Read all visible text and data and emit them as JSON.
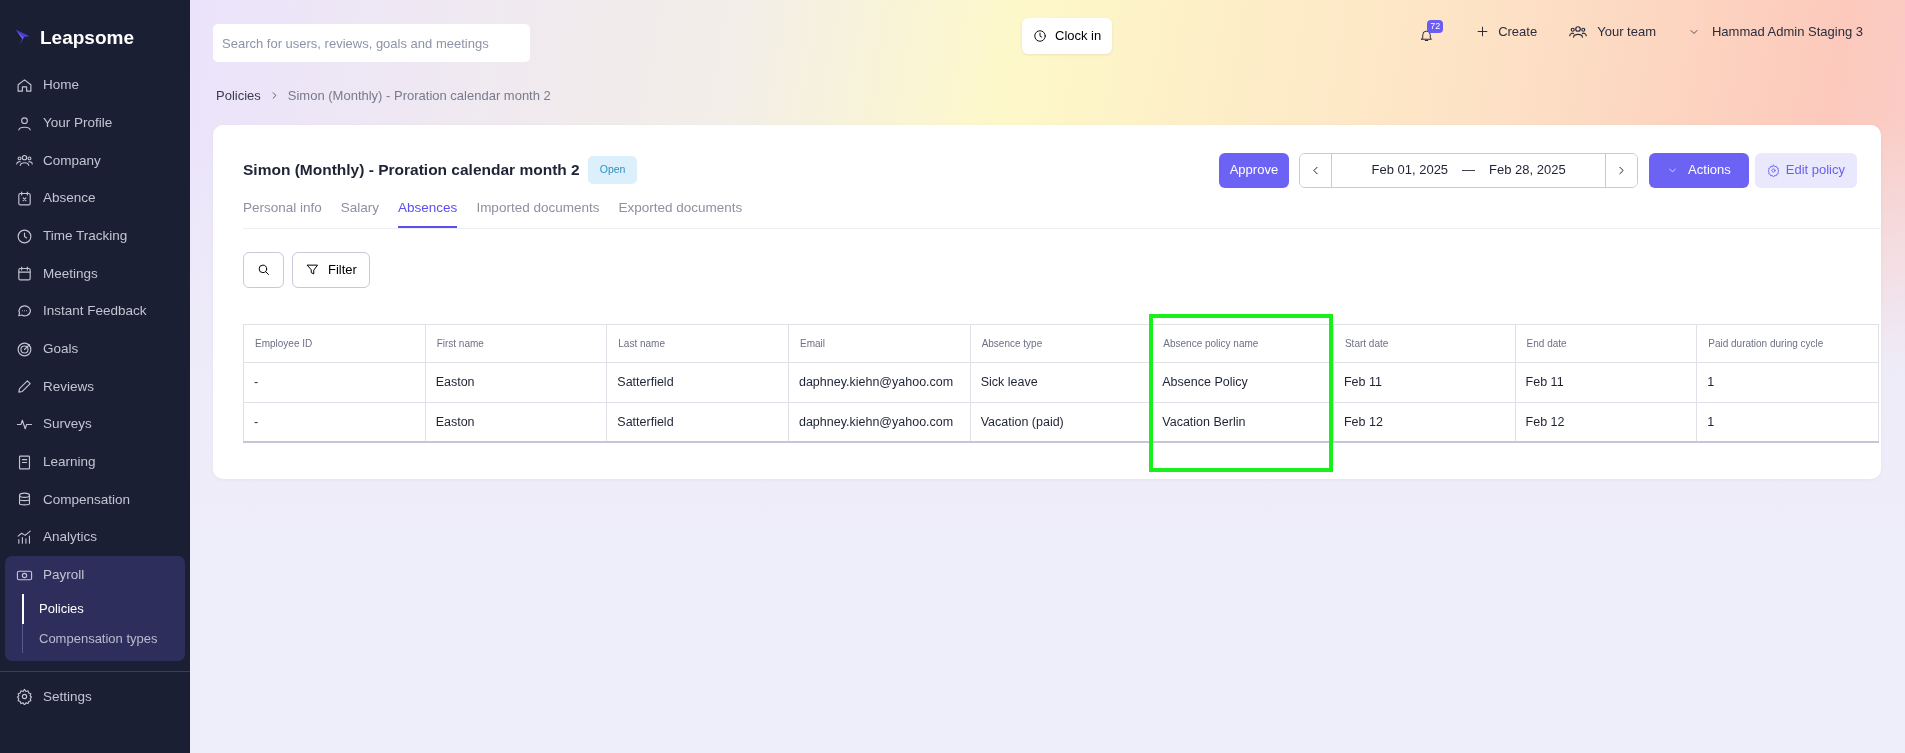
{
  "sidebar": {
    "logo": "Leapsome",
    "items": [
      {
        "label": "Home",
        "selected": false
      },
      {
        "label": "Your Profile",
        "selected": false
      },
      {
        "label": "Company",
        "selected": false
      },
      {
        "label": "Absence",
        "selected": false
      },
      {
        "label": "Time Tracking",
        "selected": false
      },
      {
        "label": "Meetings",
        "selected": false
      },
      {
        "label": "Instant Feedback",
        "selected": false
      },
      {
        "label": "Goals",
        "selected": false
      },
      {
        "label": "Reviews",
        "selected": false
      },
      {
        "label": "Surveys",
        "selected": false
      },
      {
        "label": "Learning",
        "selected": false
      },
      {
        "label": "Compensation",
        "selected": false
      },
      {
        "label": "Analytics",
        "selected": false
      },
      {
        "label": "Payroll",
        "selected": false,
        "expanded": true,
        "children": [
          {
            "label": "Policies",
            "selected": true
          },
          {
            "label": "Compensation types",
            "selected": false
          }
        ]
      }
    ],
    "footer_items": [
      {
        "label": "Settings"
      }
    ]
  },
  "topbar": {
    "search": {
      "placeholder": "Search for users, reviews, goals and meetings"
    },
    "clock_in": "Clock in",
    "notifications_count": "72",
    "create": "Create",
    "your_team": "Your team",
    "user": "Hammad Admin Staging 3"
  },
  "breadcrumb": [
    "Policies",
    "Simon (Monthly) - Proration calendar month 2"
  ],
  "policy": {
    "title": "Simon (Monthly) - Proration calendar month 2",
    "status": "Open",
    "approve": "Approve",
    "date_from": "Feb 01, 2025",
    "date_to": "Feb 28, 2025",
    "separator": "—",
    "actions": "Actions",
    "edit": "Edit policy",
    "tabs": [
      {
        "label": "Personal info",
        "selected": false
      },
      {
        "label": "Salary",
        "selected": false
      },
      {
        "label": "Absences",
        "selected": true
      },
      {
        "label": "Imported documents",
        "selected": false
      },
      {
        "label": "Exported documents",
        "selected": false
      }
    ],
    "filter": "Filter",
    "table": {
      "columns": [
        {
          "label": "Employee ID",
          "highlighted": false
        },
        {
          "label": "First name",
          "highlighted": false
        },
        {
          "label": "Last name",
          "highlighted": false
        },
        {
          "label": "Email",
          "highlighted": false
        },
        {
          "label": "Absence type",
          "highlighted": false
        },
        {
          "label": "Absence policy name",
          "highlighted": true
        },
        {
          "label": "Start date",
          "highlighted": false
        },
        {
          "label": "End date",
          "highlighted": false
        },
        {
          "label": "Paid duration during cycle",
          "highlighted": false
        }
      ],
      "rows": [
        [
          "-",
          "Easton",
          "Satterfield",
          "daphney.kiehn@yahoo.com",
          "Sick leave",
          "Absence Policy",
          "Feb 11",
          "Feb 11",
          "1"
        ],
        [
          "-",
          "Easton",
          "Satterfield",
          "daphney.kiehn@yahoo.com",
          "Vacation (paid)",
          "Vacation Berlin",
          "Feb 12",
          "Feb 12",
          "1"
        ]
      ]
    }
  }
}
